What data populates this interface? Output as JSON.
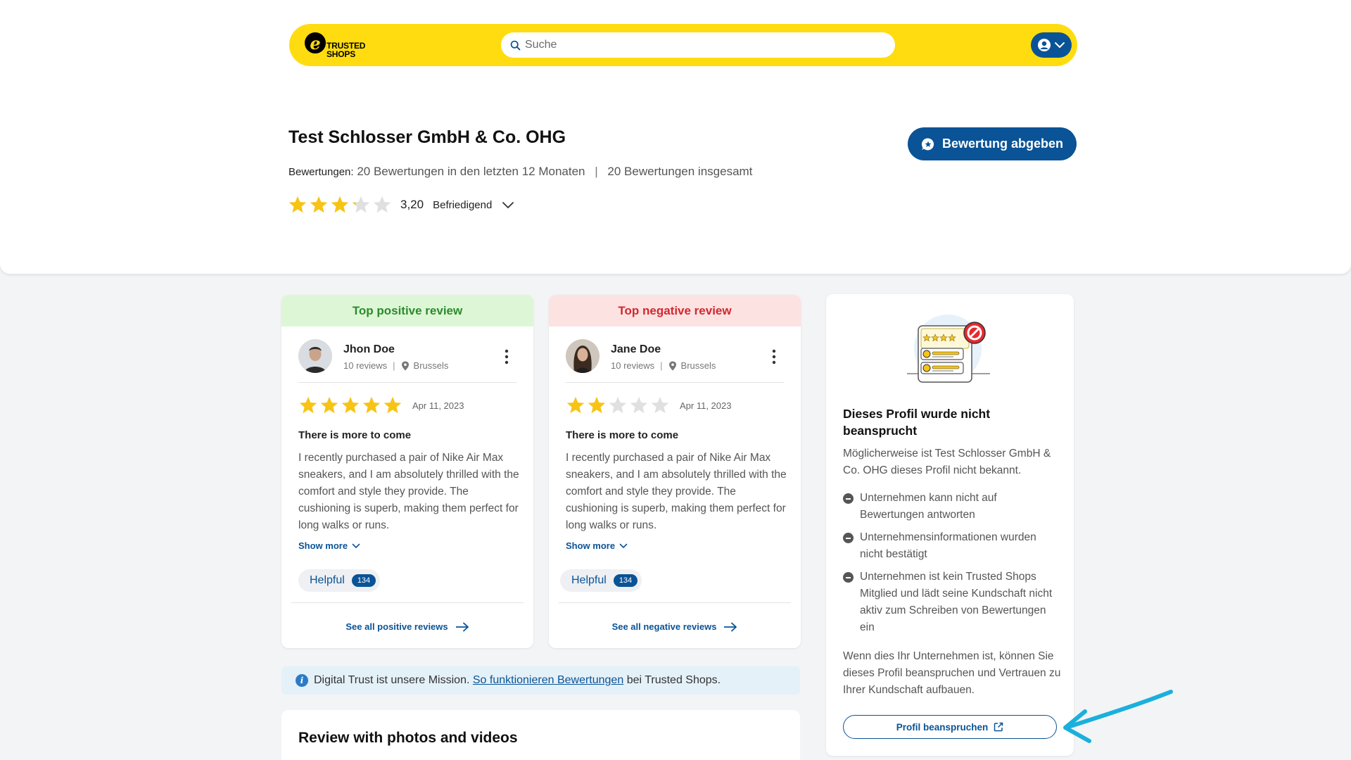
{
  "header": {
    "logo_text_line1": "TRUSTED",
    "logo_text_line2": "SHOPS",
    "logo_letter": "e",
    "search_placeholder": "Suche"
  },
  "company": {
    "name": "Test Schlosser GmbH & Co. OHG",
    "counts_label": "Bewertungen:",
    "counts_recent": "20 Bewertungen in den letzten 12 Monaten",
    "counts_separator": "|",
    "counts_total": "20 Bewertungen insgesamt",
    "rating_value": "3,20",
    "rating_label": "Befriedigend",
    "rating_stars": 3.2,
    "review_button_label": "Bewertung abgeben"
  },
  "reviews": [
    {
      "heading": "Top positive review",
      "type": "positive",
      "name": "Jhon Doe",
      "review_count": "10 reviews",
      "meta_separator": "|",
      "location": "Brussels",
      "stars": 5,
      "date": "Apr 11, 2023",
      "title": "There is more to come",
      "body": "I recently purchased a pair of Nike Air Max sneakers, and I am absolutely thrilled with the comfort and style they provide. The cushioning is superb, making them perfect for long walks or runs.",
      "show_more": "Show more",
      "helpful_label": "Helpful",
      "helpful_count": "134",
      "footer_link": "See all positive reviews"
    },
    {
      "heading": "Top negative review",
      "type": "negative",
      "name": "Jane Doe",
      "review_count": "10 reviews",
      "meta_separator": "|",
      "location": "Brussels",
      "stars": 2,
      "date": "Apr 11, 2023",
      "title": "There is more to come",
      "body": "I recently purchased a pair of Nike Air Max sneakers, and I am absolutely thrilled with the comfort and style they provide. The cushioning is superb, making them perfect for long walks or runs.",
      "show_more": "Show more",
      "helpful_label": "Helpful",
      "helpful_count": "134",
      "footer_link": "See all negative reviews"
    }
  ],
  "info_strip": {
    "text_before": "Digital Trust ist unsere Mission.",
    "link": "So funktionieren Bewertungen",
    "text_after": "bei Trusted Shops."
  },
  "photos_section": {
    "title": "Review with photos and videos"
  },
  "unclaimed": {
    "title": "Dieses Profil wurde nicht beansprucht",
    "subtitle": "Möglicherweise ist Test Schlosser GmbH & Co. OHG dieses Profil nicht bekannt.",
    "items": [
      "Unternehmen kann nicht auf Bewertungen antworten",
      "Unternehmensinformationen wurden nicht bestätigt",
      "Unternehmen ist kein Trusted Shops Mitglied und lädt seine Kundschaft nicht aktiv zum Schreiben von Bewertungen ein"
    ],
    "footer": "Wenn dies Ihr Unternehmen ist, können Sie dieses Profil beanspruchen und Vertrauen zu Ihrer Kundschaft aufbauen.",
    "claim_button": "Profil beanspruchen"
  },
  "colors": {
    "brand_yellow": "#ffdc0f",
    "brand_blue": "#0a5396",
    "star_yellow": "#f7c416",
    "star_gray": "#e0e0e0",
    "annotation_arrow": "#1bb0dc"
  },
  "icons": {
    "search": "search-icon",
    "user": "user-icon",
    "chevron": "chevron-down-icon",
    "location": "location-pin-icon",
    "kebab": "kebab-menu-icon",
    "arrow": "arrow-right-icon",
    "external": "external-link-icon",
    "info": "info-icon",
    "chat": "chat-bubble-icon"
  }
}
